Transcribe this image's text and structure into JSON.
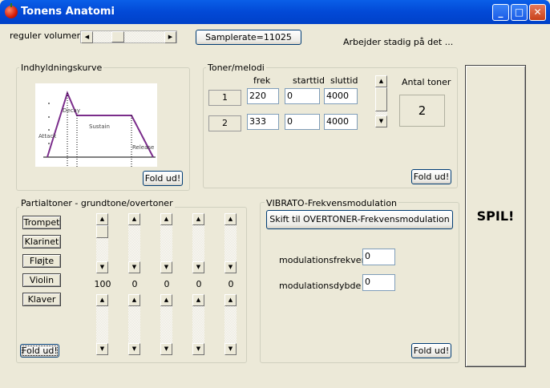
{
  "window": {
    "title": "Tonens Anatomi",
    "minimize": "_",
    "maximize": "□",
    "close": "✕",
    "app_icon": "apple-icon"
  },
  "top": {
    "volume_label": "reguler volumen",
    "samplerate_button": "Samplerate=11025",
    "status": "Arbejder stadig på det ..."
  },
  "envelope": {
    "title": "Indhyldningskurve",
    "labels": {
      "decay": "Decay",
      "sustain": "Sustain",
      "attack": "Attack",
      "release": "Release"
    },
    "fold_button": "Fold ud!"
  },
  "tones": {
    "title": "Toner/melodi",
    "headers": {
      "freq": "frek",
      "start": "starttid",
      "end": "sluttid"
    },
    "rows": [
      {
        "button": "1",
        "freq": "220",
        "start": "0",
        "end": "4000"
      },
      {
        "button": "2",
        "freq": "333",
        "start": "0",
        "end": "4000"
      }
    ],
    "count_label": "Antal toner",
    "count_value": "2",
    "fold_button": "Fold ud!"
  },
  "partials": {
    "title": "Partialtoner - grundtone/overtoner",
    "instruments": [
      "Trompet",
      "Klarinet",
      "Fløjte",
      "Violin",
      "Klaver"
    ],
    "values": [
      "100",
      "0",
      "0",
      "0",
      "0"
    ],
    "fold_button": "Fold ud!"
  },
  "vibrato": {
    "title": "VIBRATO-Frekvensmodulation",
    "switch_button": "Skift til OVERTONER-Frekvensmodulation",
    "freq_label": "modulationsfrekvens",
    "freq_value": "0",
    "depth_label": "modulationsdybde",
    "depth_value": "0",
    "fold_button": "Fold ud!"
  },
  "play_button": "SPIL!",
  "colors": {
    "titlebar": "#0a5fe8",
    "face": "#ece9d8",
    "graph_line": "#7b2d8b"
  }
}
